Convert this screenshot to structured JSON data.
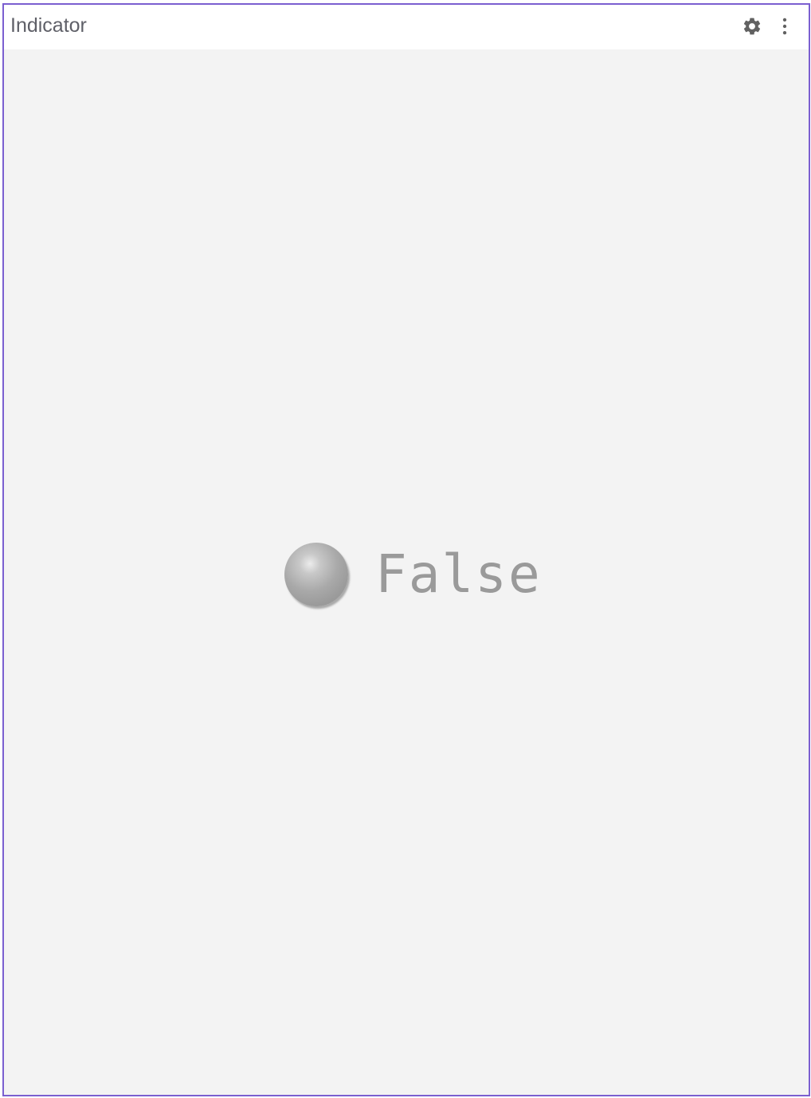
{
  "panel": {
    "title": "Indicator",
    "accent_color": "#7b5fd0",
    "header_icons": [
      "gear-icon",
      "more-vertical-icon"
    ]
  },
  "indicator": {
    "value_text": "False",
    "state": false,
    "led_color": "#a6a6a6"
  }
}
